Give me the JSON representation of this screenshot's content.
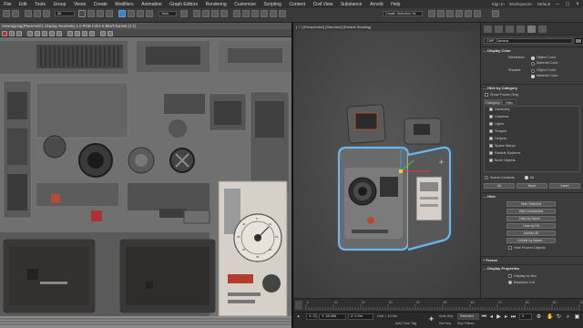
{
  "menu": {
    "items": [
      "File",
      "Edit",
      "Tools",
      "Group",
      "Views",
      "Create",
      "Modifiers",
      "Animation",
      "Graph Editors",
      "Rendering",
      "Customize",
      "Scripting",
      "Content",
      "Civil View",
      "Substance",
      "Arnold",
      "Help"
    ],
    "user": "Sign In",
    "workspace_label": "Workspaces:",
    "workspace_value": "Default"
  },
  "toolbar": {
    "selection_filter": "All",
    "view_dropdown": "View",
    "selection_set": "Create Selection Se"
  },
  "uvw": {
    "title": "Unwrapping(Placement): Display Geometry 1.0 RGB Color 8 Bits/Channel (1:1)",
    "texture_values": {
      "dial_numbers": [
        "5",
        "10",
        "15",
        "20",
        "25",
        "30",
        "35",
        "40"
      ]
    }
  },
  "viewport": {
    "label": "[ + ] [Perspective] [Standard] [Default Shading]"
  },
  "cmd": {
    "object_name": "CMP_Camera",
    "display_color": {
      "header": "Display Color",
      "wireframe_label": "Wireframe:",
      "shaded_label": "Shaded:",
      "object_color": "Object Color",
      "material_color": "Material Color"
    },
    "hide_by_category": {
      "header": "Hide by Category",
      "show_frozen": "Show Frozen Only",
      "tab_category": "Category",
      "tab_filter": "Filter",
      "items": [
        "Geometry",
        "Cameras",
        "Lights",
        "Shapes",
        "Helpers",
        "Space Warps",
        "Particle Systems",
        "Bone Objects"
      ],
      "scene_contents": "Scene Contents",
      "all_radio": "All",
      "btn_all": "All",
      "btn_none": "None",
      "btn_invert": "Invert"
    },
    "hide": {
      "header": "Hide",
      "buttons": [
        "Hide Selected",
        "Hide Unselected",
        "Hide by Name...",
        "Hide by Hit"
      ],
      "unhide_all": "Unhide All",
      "unhide_by_name": "Unhide by Name...",
      "hide_frozen": "Hide Frozen Objects"
    },
    "freeze_header": "Freeze",
    "display_props": {
      "header": "Display Properties",
      "items": [
        "Display as Box",
        "Backface Cull"
      ]
    }
  },
  "timeline": {
    "ticks": [
      "0",
      "10",
      "20",
      "30",
      "40",
      "50",
      "60",
      "70",
      "80",
      "90",
      "100"
    ]
  },
  "status": {
    "x": "X: 23.7m",
    "y": "Y: 18.468",
    "z": "Z: 0.0m",
    "grid": "Grid = 10.0m",
    "auto_key": "Auto Key",
    "selected": "Selected",
    "set_key": "Set Key",
    "key_filters": "Key Filters...",
    "add_time_tag": "Add Time Tag",
    "frame": "0"
  },
  "colors": {
    "accent": "#3a8ad8",
    "selection": "#67b7ef",
    "object_color_swatch": "#7a7a7a"
  }
}
